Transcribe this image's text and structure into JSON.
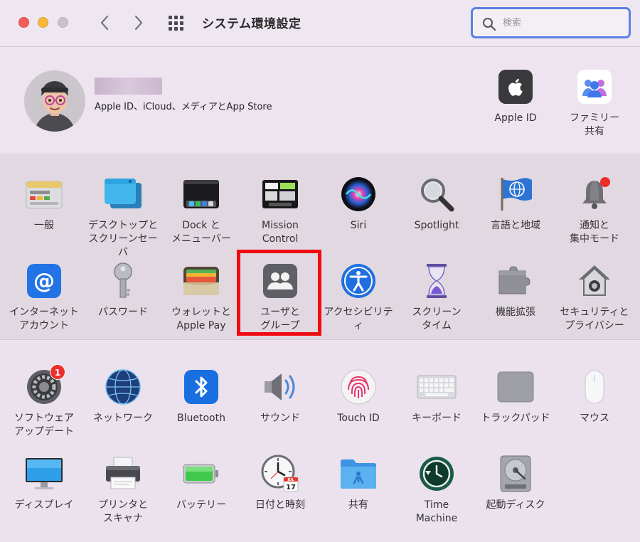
{
  "window": {
    "title": "システム環境設定",
    "search_placeholder": "検索"
  },
  "account": {
    "subtitle": "Apple ID、iCloud、メディアとApp Store",
    "apple_id_label": "Apple ID",
    "family_label": "ファミリー\n共有"
  },
  "row1": [
    {
      "label": "一般",
      "icon": "general-icon"
    },
    {
      "label": "デスクトップと\nスクリーンセーバ",
      "icon": "desktop-icon"
    },
    {
      "label": "Dock と\nメニューバー",
      "icon": "dock-icon"
    },
    {
      "label": "Mission\nControl",
      "icon": "mission-control-icon"
    },
    {
      "label": "Siri",
      "icon": "siri-icon"
    },
    {
      "label": "Spotlight",
      "icon": "spotlight-icon"
    },
    {
      "label": "言語と地域",
      "icon": "language-flag-icon"
    },
    {
      "label": "通知と\n集中モード",
      "icon": "bell-icon"
    }
  ],
  "row2": [
    {
      "label": "インターネット\nアカウント",
      "icon": "at-icon"
    },
    {
      "label": "パスワード",
      "icon": "key-icon"
    },
    {
      "label": "ウォレットと\nApple Pay",
      "icon": "wallet-icon"
    },
    {
      "label": "ユーザと\nグループ",
      "icon": "users-icon"
    },
    {
      "label": "アクセシビリティ",
      "icon": "accessibility-icon"
    },
    {
      "label": "スクリーン\nタイム",
      "icon": "hourglass-icon"
    },
    {
      "label": "機能拡張",
      "icon": "puzzle-icon"
    },
    {
      "label": "セキュリティと\nプライバシー",
      "icon": "security-house-icon"
    }
  ],
  "row3": [
    {
      "label": "ソフトウェア\nアップデート",
      "icon": "gear-icon",
      "badge": "1"
    },
    {
      "label": "ネットワーク",
      "icon": "globe-icon"
    },
    {
      "label": "Bluetooth",
      "icon": "bluetooth-icon"
    },
    {
      "label": "サウンド",
      "icon": "speaker-icon"
    },
    {
      "label": "Touch ID",
      "icon": "fingerprint-icon"
    },
    {
      "label": "キーボード",
      "icon": "keyboard-icon"
    },
    {
      "label": "トラックパッド",
      "icon": "trackpad-icon"
    },
    {
      "label": "マウス",
      "icon": "mouse-icon"
    }
  ],
  "row4": [
    {
      "label": "ディスプレイ",
      "icon": "display-icon"
    },
    {
      "label": "プリンタと\nスキャナ",
      "icon": "printer-icon"
    },
    {
      "label": "バッテリー",
      "icon": "battery-icon"
    },
    {
      "label": "日付と時刻",
      "icon": "clock-icon",
      "calendar_month": "JUL",
      "calendar_day": "17"
    },
    {
      "label": "共有",
      "icon": "shared-folder-icon"
    },
    {
      "label": "Time\nMachine",
      "icon": "time-machine-icon"
    },
    {
      "label": "起動ディスク",
      "icon": "startup-disk-icon"
    }
  ]
}
